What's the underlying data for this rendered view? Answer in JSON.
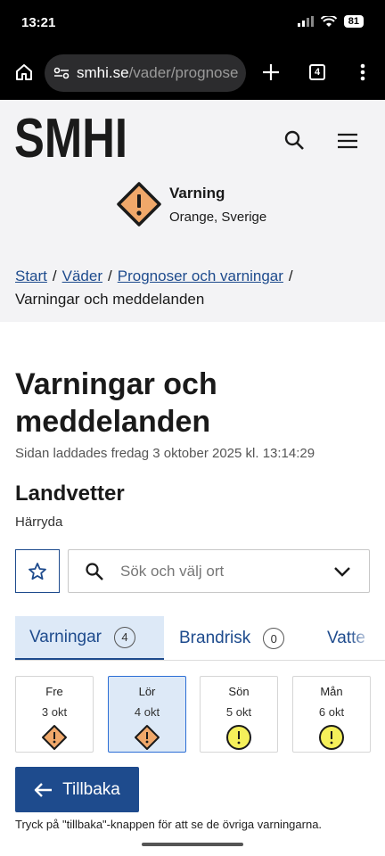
{
  "status": {
    "time": "13:21",
    "battery": "81"
  },
  "browser": {
    "url_host": "smhi.se",
    "url_path": "/vader/prognose",
    "tab_count": "4"
  },
  "header": {
    "logo_text": "SMHI",
    "alert": {
      "title": "Varning",
      "subtitle": "Orange, Sverige"
    },
    "breadcrumbs": [
      "Start",
      "Väder",
      "Prognoser och varningar",
      "Varningar och meddelanden"
    ]
  },
  "main": {
    "title": "Varningar och meddelanden",
    "loaded": "Sidan laddades fredag 3 oktober 2025 kl. 13:14:29",
    "place": "Landvetter",
    "subplace": "Härryda",
    "search_placeholder": "Sök och välj ort",
    "tabs": [
      {
        "label": "Varningar",
        "count": "4"
      },
      {
        "label": "Brandrisk",
        "count": "0"
      },
      {
        "label": "Vatte"
      }
    ],
    "days": [
      {
        "name": "Fre",
        "date": "3 okt",
        "level": "orange"
      },
      {
        "name": "Lör",
        "date": "4 okt",
        "level": "orange"
      },
      {
        "name": "Sön",
        "date": "5 okt",
        "level": "yellow"
      },
      {
        "name": "Mån",
        "date": "6 okt",
        "level": "yellow"
      }
    ],
    "back_label": "Tillbaka",
    "hint": "Tryck på \"tillbaka\"-knappen för att se de övriga varningarna."
  },
  "colors": {
    "brand_blue": "#1e4b8d",
    "orange_warning": "#f0a86a",
    "yellow_warning": "#f5f05a"
  },
  "icons": [
    "home-icon",
    "site-settings-icon",
    "plus-icon",
    "tabs-icon",
    "more-icon",
    "search-icon",
    "menu-icon",
    "warning-icon",
    "star-icon",
    "chevron-down-icon",
    "arrow-left-icon"
  ]
}
